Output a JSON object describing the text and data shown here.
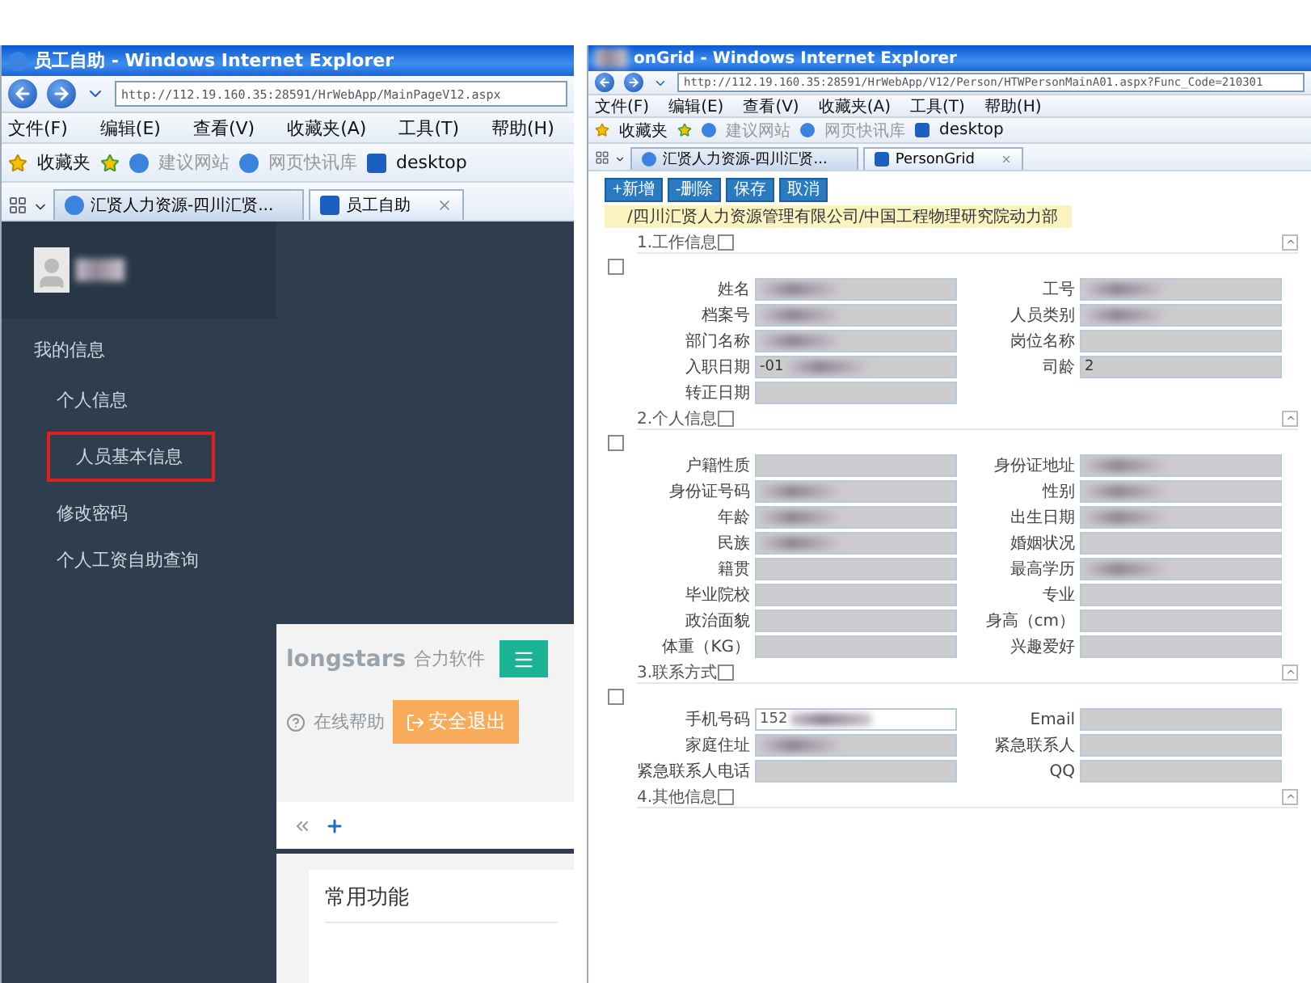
{
  "left_window": {
    "title": "员工自助 - Windows Internet Explorer",
    "address": "http://112.19.160.35:28591/HrWebApp/MainPageV12.aspx",
    "menu": [
      "文件(F)",
      "编辑(E)",
      "查看(V)",
      "收藏夹(A)",
      "工具(T)",
      "帮助(H)"
    ],
    "favorites": {
      "label": "收藏夹",
      "links": [
        "建议网站",
        "网页快讯库",
        "desktop"
      ]
    },
    "tabs": [
      {
        "label": "汇贤人力资源-四川汇贤...",
        "selected": false
      },
      {
        "label": "员工自助",
        "selected": true
      }
    ],
    "sidebar": {
      "section": "我的信息",
      "items": [
        {
          "label": "个人信息",
          "selected": false,
          "children": [
            {
              "label": "人员基本信息",
              "selected": true
            }
          ]
        },
        {
          "label": "修改密码",
          "selected": false
        },
        {
          "label": "个人工资自助查询",
          "selected": false
        }
      ]
    },
    "header": {
      "logo": "longstars",
      "logo_subtitle": "合力软件",
      "help": "在线帮助",
      "logout": "安全退出"
    },
    "card": {
      "title": "常用功能"
    }
  },
  "right_window": {
    "title": "onGrid - Windows Internet Explorer",
    "address": "http://112.19.160.35:28591/HrWebApp/V12/Person/HTWPersonMainA01.aspx?Func_Code=210301",
    "menu": [
      "文件(F)",
      "编辑(E)",
      "查看(V)",
      "收藏夹(A)",
      "工具(T)",
      "帮助(H)"
    ],
    "favorites": {
      "label": "收藏夹",
      "links": [
        "建议网站",
        "网页快讯库",
        "desktop"
      ]
    },
    "tabs": [
      {
        "label": "汇贤人力资源-四川汇贤...",
        "selected": false
      },
      {
        "label": "PersonGrid",
        "selected": true
      }
    ],
    "toolbar": [
      "+新增",
      "-删除",
      "保存",
      "取消"
    ],
    "path": "/四川汇贤人力资源管理有限公司/中国工程物理研究院动力部",
    "sections": [
      {
        "title": "1.工作信息",
        "fields": [
          {
            "label": "姓名",
            "redacted": true,
            "editable": false
          },
          {
            "label": "工号",
            "redacted": true,
            "editable": false
          },
          {
            "label": "档案号",
            "redacted": true,
            "editable": false
          },
          {
            "label": "人员类别",
            "redacted": true,
            "editable": false
          },
          {
            "label": "部门名称",
            "redacted": true,
            "editable": false
          },
          {
            "label": "岗位名称",
            "redacted": false,
            "editable": false
          },
          {
            "label": "入职日期",
            "value": "-01",
            "redacted": true,
            "editable": false
          },
          {
            "label": "司龄",
            "value": "2",
            "redacted": false,
            "editable": false
          },
          {
            "label": "转正日期",
            "redacted": false,
            "editable": false
          }
        ]
      },
      {
        "title": "2.个人信息",
        "fields": [
          {
            "label": "户籍性质",
            "redacted": false,
            "editable": false
          },
          {
            "label": "身份证地址",
            "redacted": true,
            "editable": false
          },
          {
            "label": "身份证号码",
            "redacted": true,
            "editable": false
          },
          {
            "label": "性别",
            "redacted": true,
            "editable": false
          },
          {
            "label": "年龄",
            "redacted": true,
            "editable": false
          },
          {
            "label": "出生日期",
            "redacted": true,
            "editable": false
          },
          {
            "label": "民族",
            "redacted": true,
            "editable": false
          },
          {
            "label": "婚姻状况",
            "redacted": false,
            "editable": false
          },
          {
            "label": "籍贯",
            "redacted": false,
            "editable": false
          },
          {
            "label": "最高学历",
            "redacted": true,
            "editable": false
          },
          {
            "label": "毕业院校",
            "redacted": false,
            "editable": false
          },
          {
            "label": "专业",
            "redacted": false,
            "editable": false
          },
          {
            "label": "政治面貌",
            "redacted": false,
            "editable": false
          },
          {
            "label": "身高（cm）",
            "redacted": false,
            "editable": false
          },
          {
            "label": "体重（KG）",
            "redacted": false,
            "editable": false
          },
          {
            "label": "兴趣爱好",
            "redacted": false,
            "editable": false
          }
        ]
      },
      {
        "title": "3.联系方式",
        "fields": [
          {
            "label": "手机号码",
            "value": "152",
            "redacted": true,
            "editable": true
          },
          {
            "label": "Email",
            "redacted": false,
            "editable": false
          },
          {
            "label": "家庭住址",
            "redacted": true,
            "editable": false
          },
          {
            "label": "紧急联系人",
            "redacted": false,
            "editable": false
          },
          {
            "label": "紧急联系人电话",
            "redacted": false,
            "editable": false
          },
          {
            "label": "QQ",
            "redacted": false,
            "editable": false
          }
        ]
      },
      {
        "title": "4.其他信息"
      }
    ]
  }
}
